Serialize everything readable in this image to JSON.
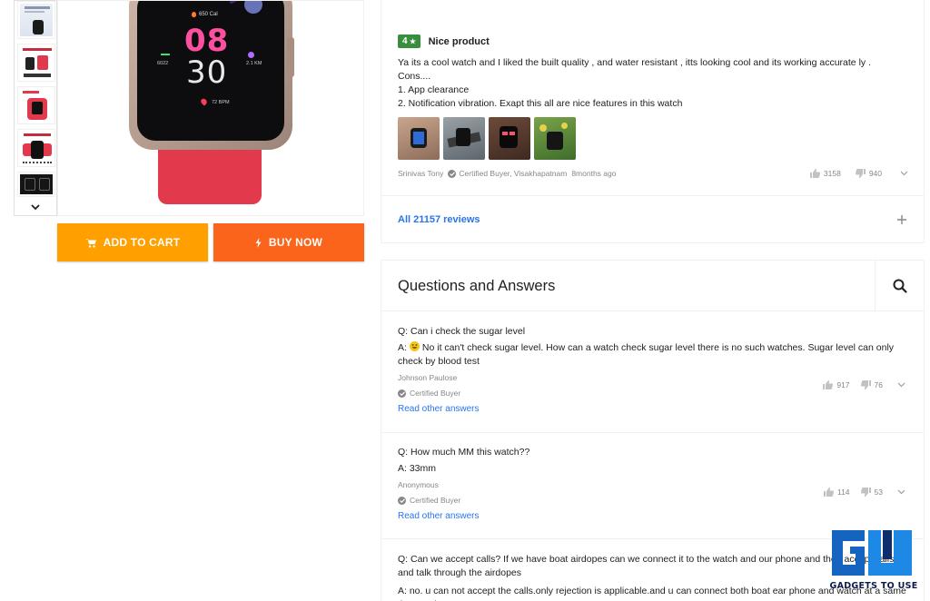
{
  "buttons": {
    "add_to_cart": "ADD TO CART",
    "buy_now": "BUY NOW"
  },
  "watch_face": {
    "calories": "650 Cal",
    "hour": "08",
    "minute": "30",
    "steps": "6022",
    "distance": "2.1 KM",
    "bpm": "72 BPM"
  },
  "review": {
    "rating": "4",
    "title": "Nice product",
    "text_lines": [
      "Ya its a cool watch and I liked the built quality , and water resistant , itts looking cool and its working accurate ly .",
      "Cons....",
      "1. App clearance",
      "2. Notification vibration. Exapt this all are nice features in this watch"
    ],
    "author": "Srinivas Tony",
    "certified": "Certified Buyer, Visakhapatnam",
    "time": "8months ago",
    "likes": "3158",
    "dislikes": "940"
  },
  "all_reviews": "All 21157 reviews",
  "qa": {
    "title": "Questions and Answers",
    "items": [
      {
        "question": "Q: Can i check the sugar level",
        "answer_prefix": "A:",
        "answer": "No it can't check sugar level. How can a watch check sugar level there is no such watches. Sugar level can only check by blood test",
        "author": "Johnson Paulose",
        "certified": "Certified Buyer",
        "read_other": "Read other answers",
        "likes": "917",
        "dislikes": "76"
      },
      {
        "question": "Q: How much MM this watch??",
        "answer_prefix": "A:",
        "answer": "33mm",
        "author": "Anonymous",
        "certified": "Certified Buyer",
        "read_other": "Read other answers",
        "likes": "114",
        "dislikes": "53"
      },
      {
        "question": "Q: Can we accept calls? If we have boat airdopes can we connect it to the watch and our phone and then accept calls and talk through the airdopes",
        "answer_prefix": "A:",
        "answer": "no. u can not accept the calls.only rejection is applicable.and u can connect both boat ear phone and watch at a same time to phone"
      }
    ]
  },
  "watermark": {
    "text": "GADGETS TO USE"
  },
  "colors": {
    "cart": "#ff9f00",
    "buy": "#fb641b",
    "link": "#2874f0",
    "rating": "#388e3c",
    "watch_strap": "#e23a4c"
  }
}
